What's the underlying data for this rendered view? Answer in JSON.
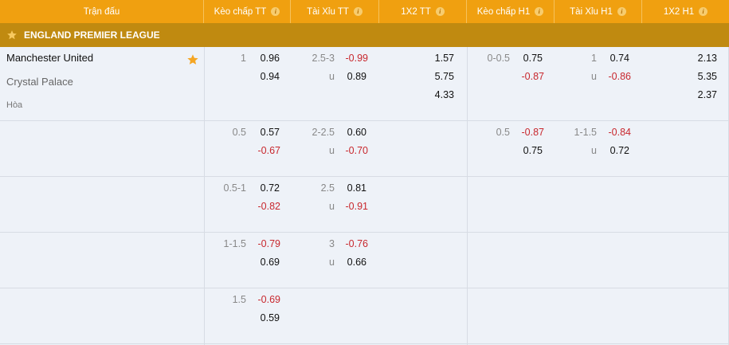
{
  "header": {
    "match": "Trận đấu",
    "hdp_ft": "Kèo chấp TT",
    "ou_ft": "Tài Xỉu TT",
    "x12_ft": "1X2 TT",
    "hdp_h1": "Kèo chấp H1",
    "ou_h1": "Tài Xỉu H1",
    "x12_h1": "1X2 H1",
    "info_glyph": "i"
  },
  "league": {
    "name": "ENGLAND PREMIER LEAGUE",
    "icon": "star-icon"
  },
  "match": {
    "home": "Manchester United",
    "away": "Crystal Palace",
    "draw": "Hòa",
    "favorite_icon": "star-icon"
  },
  "odds": {
    "r1": {
      "hdp_ft": {
        "line": "1",
        "home": "0.96",
        "away": "0.94"
      },
      "ou_ft": {
        "line": "2.5-3",
        "over": "-0.99",
        "under_label": "u",
        "under": "0.89"
      },
      "x12_ft": {
        "home": "1.57",
        "away": "5.75",
        "draw": "4.33"
      },
      "hdp_h1": {
        "line": "0-0.5",
        "home": "0.75",
        "away": "-0.87"
      },
      "ou_h1": {
        "line": "1",
        "over": "0.74",
        "under_label": "u",
        "under": "-0.86"
      },
      "x12_h1": {
        "home": "2.13",
        "away": "5.35",
        "draw": "2.37"
      }
    },
    "r2": {
      "hdp_ft": {
        "line": "0.5",
        "home": "0.57",
        "away": "-0.67"
      },
      "ou_ft": {
        "line": "2-2.5",
        "over": "0.60",
        "under_label": "u",
        "under": "-0.70"
      },
      "hdp_h1": {
        "line": "0.5",
        "home": "-0.87",
        "away": "0.75"
      },
      "ou_h1": {
        "line": "1-1.5",
        "over": "-0.84",
        "under_label": "u",
        "under": "0.72"
      }
    },
    "r3": {
      "hdp_ft": {
        "line": "0.5-1",
        "home": "0.72",
        "away": "-0.82"
      },
      "ou_ft": {
        "line": "2.5",
        "over": "0.81",
        "under_label": "u",
        "under": "-0.91"
      }
    },
    "r4": {
      "hdp_ft": {
        "line": "1-1.5",
        "home": "-0.79",
        "away": "0.69"
      },
      "ou_ft": {
        "line": "3",
        "over": "-0.76",
        "under_label": "u",
        "under": "0.66"
      }
    },
    "r5": {
      "hdp_ft": {
        "line": "1.5",
        "home": "-0.69",
        "away": "0.59"
      }
    }
  },
  "colors": {
    "header_bg": "#f0a010",
    "league_bg": "#c08a10",
    "positive": "#111111",
    "negative": "#c8282e",
    "star": "#f5a623"
  }
}
